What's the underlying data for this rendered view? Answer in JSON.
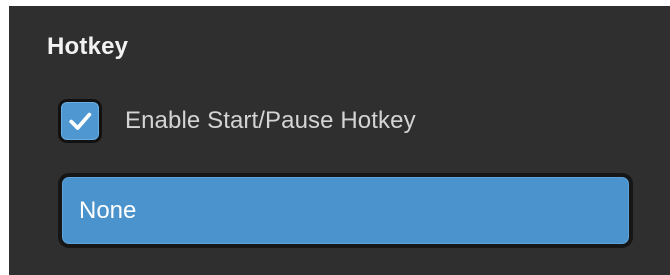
{
  "section": {
    "title": "Hotkey"
  },
  "enable_hotkey": {
    "label": "Enable Start/Pause Hotkey",
    "checked": true,
    "icon": "checkmark-icon"
  },
  "hotkey_field": {
    "value": "None"
  },
  "colors": {
    "panel_background": "#2f2f2f",
    "accent_blue": "#4a93cc",
    "text_primary": "#f2f2f2",
    "text_secondary": "#d4d4d4"
  }
}
